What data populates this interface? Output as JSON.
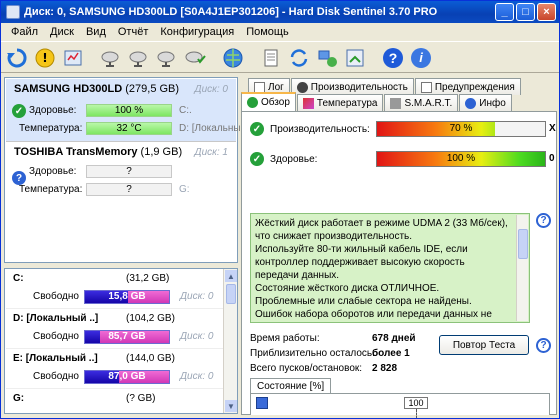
{
  "window": {
    "title": "Диск: 0, SAMSUNG HD300LD [S0A4J1EP301206]  -  Hard Disk Sentinel 3.70 PRO"
  },
  "menu": [
    "Файл",
    "Диск",
    "Вид",
    "Отчёт",
    "Конфигурация",
    "Помощь"
  ],
  "disks": [
    {
      "name": "SAMSUNG HD300LD",
      "size": "(279,5 GB)",
      "disk_label": "Диск: 0",
      "health_label": "Здоровье:",
      "health_value": "100 %",
      "health_aux": "C:.",
      "temp_label": "Температура:",
      "temp_value": "32 °C",
      "temp_aux": "D: [Локальный",
      "status": "ok"
    },
    {
      "name": "TOSHIBA TransMemory",
      "size": "(1,9 GB)",
      "disk_label": "Диск: 1",
      "health_label": "Здоровье:",
      "health_value": "?",
      "health_aux": "",
      "temp_label": "Температура:",
      "temp_value": "?",
      "temp_aux": "G:",
      "status": "unknown"
    }
  ],
  "volumes": [
    {
      "name": "C:",
      "size": "(31,2 GB)",
      "free_label": "Свободно",
      "free_value": "15,8 GB",
      "free_pct": 51,
      "disk": "Диск: 0"
    },
    {
      "name": "D: [Локальный ..]",
      "size": "(104,2 GB)",
      "free_label": "Свободно",
      "free_value": "85,7 GB",
      "free_pct": 18,
      "disk": "Диск: 0"
    },
    {
      "name": "E: [Локальный ..]",
      "size": "(144,0 GB)",
      "free_label": "Свободно",
      "free_value": "87,0 GB",
      "free_pct": 40,
      "disk": "Диск: 0"
    },
    {
      "name": "G:",
      "size": "(? GB)",
      "free_label": "",
      "free_value": "",
      "free_pct": 0,
      "disk": ""
    }
  ],
  "tabs": {
    "row1": [
      "Лог",
      "Производительность",
      "Предупреждения"
    ],
    "row2": [
      "Обзор",
      "Температура",
      "S.M.A.R.T.",
      "Инфо"
    ],
    "active": "Обзор"
  },
  "overview": {
    "performance_label": "Производительность:",
    "performance_value": "70 %",
    "performance_pct": 70,
    "performance_end": "X",
    "health_label": "Здоровье:",
    "health_value": "100 %",
    "health_pct": 100,
    "health_end": "0",
    "description": [
      "Жёсткий диск работает в режиме UDMA 2 (33 Мб/сек), что снижает производительность.",
      "Используйте 80-ти жильный кабель IDE, если контроллер поддерживает высокую скорость передачи данных.",
      "Состояние жёсткого диска ОТЛИЧНОЕ.",
      "Проблемные или слабые сектора не найдены.",
      "Ошибок набора оборотов или передачи данных не"
    ],
    "uptime_label": "Время работы:",
    "uptime_value": "678 дней",
    "remaining_label": "Приблизительно осталось:",
    "remaining_value": "более 1",
    "starts_label": "Всего пусков/остановок:",
    "starts_value": "2 828",
    "retest_button": "Повтор Теста",
    "subtab_label": "Состояние [%]",
    "graph_marker": "100"
  },
  "colors": {
    "titlebar": "#0a5cd5",
    "selected_disk": "#d9e6fb",
    "info_box": "#d7f2c7"
  }
}
